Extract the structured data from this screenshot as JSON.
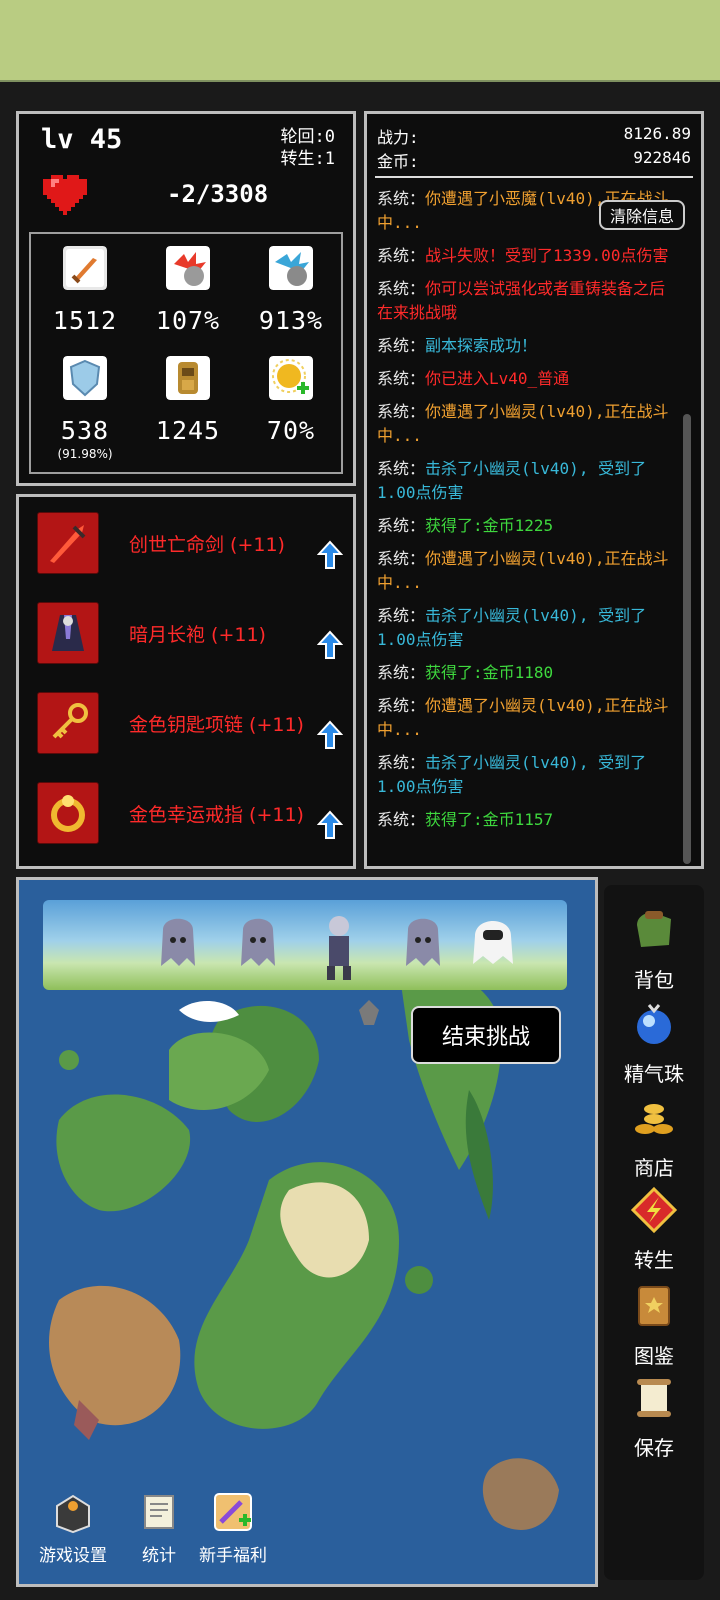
{
  "stats": {
    "level": "lv 45",
    "lunhui": "轮回:0",
    "zhuansheng": "转生:1",
    "hp": "-2/3308",
    "attack": "1512",
    "crit_rate": "107%",
    "crit_dmg": "913%",
    "defense": "538",
    "defense_pct": "(91.98%)",
    "toughness": "1245",
    "luck": "70%"
  },
  "equipment": [
    {
      "name": "创世亡命剑 (+11)",
      "icon": "red-sword-icon"
    },
    {
      "name": "暗月长袍 (+11)",
      "icon": "dark-robe-icon"
    },
    {
      "name": "金色钥匙项链 (+11)",
      "icon": "gold-key-necklace-icon"
    },
    {
      "name": "金色幸运戒指 (+11)",
      "icon": "gold-ring-icon"
    }
  ],
  "log": {
    "power_label": "战力:",
    "power_value": "8126.89",
    "gold_label": "金币:",
    "gold_value": "922846",
    "clear_label": "清除信息",
    "entries": [
      {
        "prefix": "系统：",
        "text": "你遭遇了小恶魔(lv40),正在战斗中...",
        "color": "#f0a030"
      },
      {
        "prefix": "系统：",
        "text": "战斗失败！受到了1339.00点伤害",
        "color": "#ff2a2a"
      },
      {
        "prefix": "系统：",
        "text": "你可以尝试强化或者重铸装备之后在来挑战哦",
        "color": "#ff2a2a"
      },
      {
        "prefix": "系统：",
        "text": "副本探索成功！",
        "color": "#38b8d8"
      },
      {
        "prefix": "系统：",
        "text": "你已进入Lv40_普通",
        "color": "#ff2a2a"
      },
      {
        "prefix": "系统：",
        "text": "你遭遇了小幽灵(lv40),正在战斗中...",
        "color": "#f0a030"
      },
      {
        "prefix": "系统：",
        "text": "击杀了小幽灵(lv40), 受到了1.00点伤害",
        "color": "#38b8d8"
      },
      {
        "prefix": "系统：",
        "text": "获得了:金币1225",
        "color": "#3ed83e"
      },
      {
        "prefix": "系统：",
        "text": "你遭遇了小幽灵(lv40),正在战斗中...",
        "color": "#f0a030"
      },
      {
        "prefix": "系统：",
        "text": "击杀了小幽灵(lv40), 受到了1.00点伤害",
        "color": "#38b8d8"
      },
      {
        "prefix": "系统：",
        "text": "获得了:金币1180",
        "color": "#3ed83e"
      },
      {
        "prefix": "系统：",
        "text": "你遭遇了小幽灵(lv40),正在战斗中...",
        "color": "#f0a030"
      },
      {
        "prefix": "系统：",
        "text": "击杀了小幽灵(lv40), 受到了1.00点伤害",
        "color": "#38b8d8"
      },
      {
        "prefix": "系统：",
        "text": "获得了:金币1157",
        "color": "#3ed83e"
      }
    ]
  },
  "map": {
    "end_challenge": "结束挑战",
    "bottom": {
      "settings": "游戏设置",
      "statistics": "统计",
      "newbie": "新手福利"
    }
  },
  "side_menu": {
    "bag": "背包",
    "essence": "精气珠",
    "shop": "商店",
    "rebirth": "转生",
    "codex": "图鉴",
    "save": "保存"
  },
  "colors": {
    "topbar": "#b9cc82",
    "equip_name": "#ff2a2a",
    "log_orange": "#f0a030",
    "log_red": "#ff2a2a",
    "log_cyan": "#38b8d8",
    "log_green": "#3ed83e"
  }
}
